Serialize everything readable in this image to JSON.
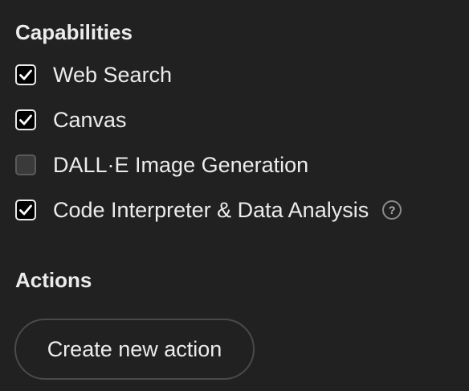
{
  "capabilities": {
    "title": "Capabilities",
    "items": [
      {
        "label": "Web Search",
        "checked": true,
        "help": false
      },
      {
        "label": "Canvas",
        "checked": true,
        "help": false
      },
      {
        "label": "DALL·E Image Generation",
        "checked": false,
        "help": false
      },
      {
        "label": "Code Interpreter & Data Analysis",
        "checked": true,
        "help": true,
        "help_glyph": "?"
      }
    ]
  },
  "actions": {
    "title": "Actions",
    "create_button_label": "Create new action"
  },
  "colors": {
    "background": "#212121",
    "text": "#ececec",
    "checkbox_checked_bg": "#000000",
    "checkbox_unchecked_bg": "#3a3a3a",
    "button_border": "#4a4a4a"
  },
  "icons": {
    "checked": "checkmark-icon",
    "help": "question-circle-icon"
  }
}
